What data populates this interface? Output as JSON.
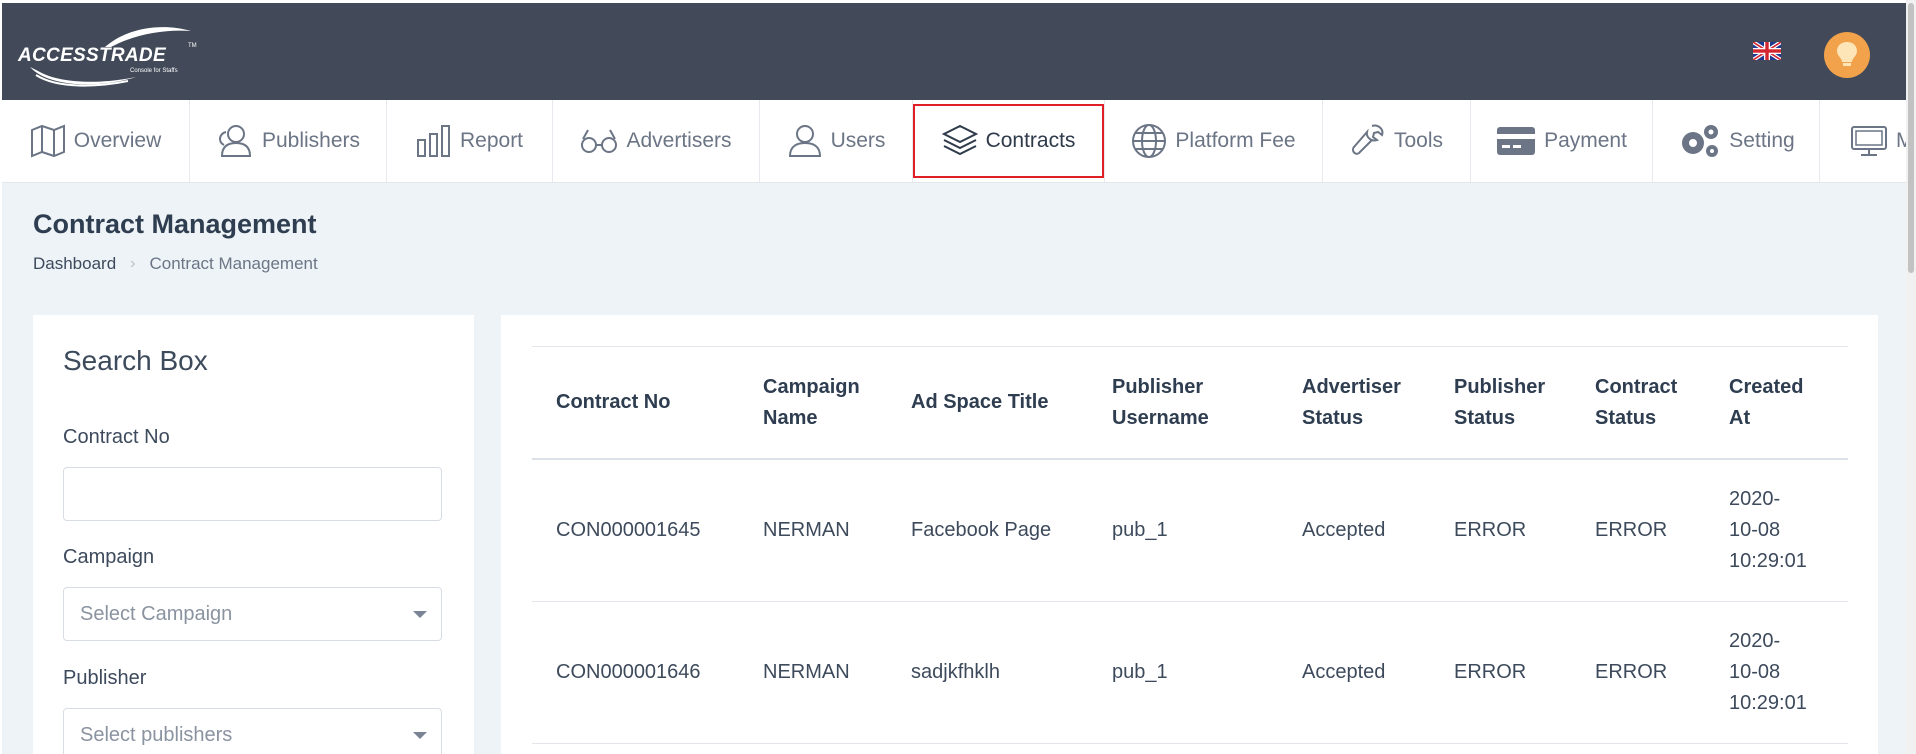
{
  "header": {
    "logo_text": "ACCESSTRADE",
    "logo_tm": "TM",
    "logo_subtitle": "Console for Staffs",
    "language_icon": "uk-flag-icon",
    "user_icon": "lightbulb-icon",
    "brand_color": "#424a59",
    "avatar_color": "#f2a24a"
  },
  "nav": {
    "items": [
      {
        "label": "Overview",
        "icon": "map-icon"
      },
      {
        "label": "Publishers",
        "icon": "users-icon"
      },
      {
        "label": "Report",
        "icon": "bar-chart-icon"
      },
      {
        "label": "Advertisers",
        "icon": "glasses-icon"
      },
      {
        "label": "Users",
        "icon": "user-icon"
      },
      {
        "label": "Contracts",
        "icon": "layers-icon",
        "active": true
      },
      {
        "label": "Platform Fee",
        "icon": "globe-icon"
      },
      {
        "label": "Tools",
        "icon": "wrench-icon"
      },
      {
        "label": "Payment",
        "icon": "credit-card-icon"
      },
      {
        "label": "Setting",
        "icon": "gears-icon"
      },
      {
        "label": "M",
        "icon": "monitor-icon"
      }
    ],
    "active_highlight_color": "#e01e26"
  },
  "page": {
    "title": "Contract Management",
    "breadcrumb": [
      "Dashboard",
      "Contract Management"
    ]
  },
  "search_box": {
    "title": "Search Box",
    "contract_no_label": "Contract No",
    "contract_no_value": "",
    "campaign_label": "Campaign",
    "campaign_placeholder": "Select Campaign",
    "publisher_label": "Publisher",
    "publisher_placeholder": "Select publishers"
  },
  "table": {
    "columns": [
      [
        "Contract No"
      ],
      [
        "Campaign",
        "Name"
      ],
      [
        "Ad Space Title"
      ],
      [
        "Publisher",
        "Username"
      ],
      [
        "Advertiser",
        "Status"
      ],
      [
        "Publisher",
        "Status"
      ],
      [
        "Contract",
        "Status"
      ],
      [
        "Created",
        "At"
      ]
    ],
    "rows": [
      {
        "contract_no": "CON000001645",
        "campaign_name": "NERMAN",
        "ad_space_title": "Facebook Page",
        "publisher_username": "pub_1",
        "advertiser_status": "Accepted",
        "publisher_status": "ERROR",
        "contract_status": "ERROR",
        "created_at": [
          "2020-",
          "10-08",
          "10:29:01"
        ]
      },
      {
        "contract_no": "CON000001646",
        "campaign_name": "NERMAN",
        "ad_space_title": "sadjkfhklh",
        "publisher_username": "pub_1",
        "advertiser_status": "Accepted",
        "publisher_status": "ERROR",
        "contract_status": "ERROR",
        "created_at": [
          "2020-",
          "10-08",
          "10:29:01"
        ]
      }
    ]
  }
}
